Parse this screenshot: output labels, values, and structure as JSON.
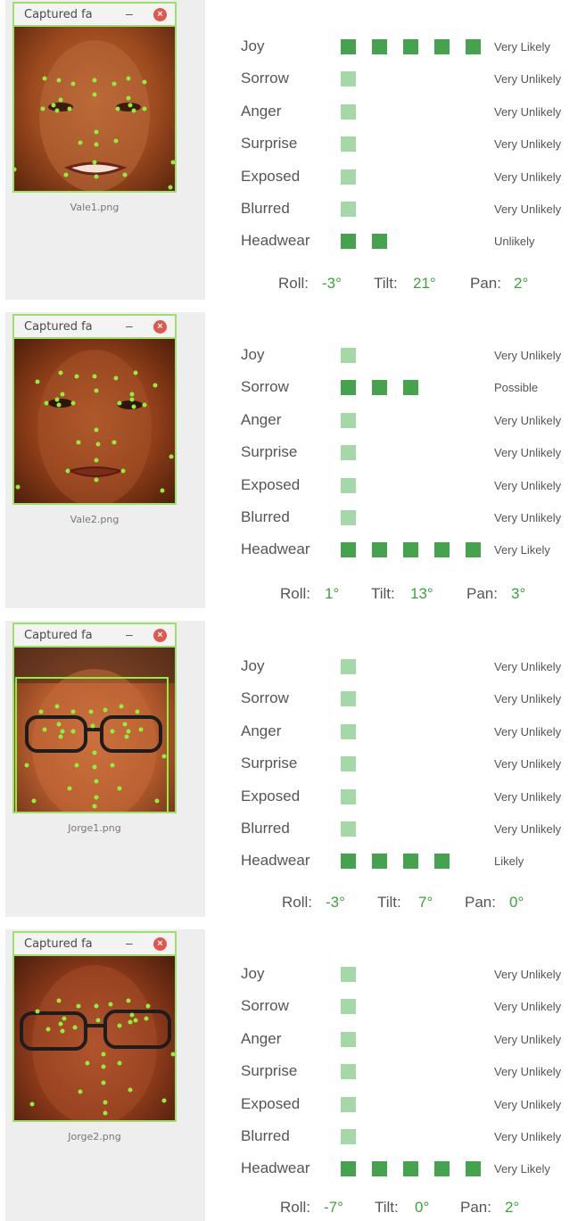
{
  "entries": [
    {
      "window_title": "Captured fa",
      "filename": "Vale1.png",
      "rows": [
        {
          "label": "Joy",
          "level": 5,
          "likelihood": "Very Likely"
        },
        {
          "label": "Sorrow",
          "level": 1,
          "likelihood": "Very Unlikely"
        },
        {
          "label": "Anger",
          "level": 1,
          "likelihood": "Very Unlikely"
        },
        {
          "label": "Surprise",
          "level": 1,
          "likelihood": "Very Unlikely"
        },
        {
          "label": "Exposed",
          "level": 1,
          "likelihood": "Very Unlikely"
        },
        {
          "label": "Blurred",
          "level": 1,
          "likelihood": "Very Unlikely"
        },
        {
          "label": "Headwear",
          "level": 2,
          "likelihood": "Unlikely"
        }
      ],
      "roll_label": "Roll:",
      "roll": "-3°",
      "tilt_label": "Tilt:",
      "tilt": "21°",
      "pan_label": "Pan:",
      "pan": "2°"
    },
    {
      "window_title": "Captured fa",
      "filename": "Vale2.png",
      "rows": [
        {
          "label": "Joy",
          "level": 1,
          "likelihood": "Very Unlikely"
        },
        {
          "label": "Sorrow",
          "level": 3,
          "likelihood": "Possible"
        },
        {
          "label": "Anger",
          "level": 1,
          "likelihood": "Very Unlikely"
        },
        {
          "label": "Surprise",
          "level": 1,
          "likelihood": "Very Unlikely"
        },
        {
          "label": "Exposed",
          "level": 1,
          "likelihood": "Very Unlikely"
        },
        {
          "label": "Blurred",
          "level": 1,
          "likelihood": "Very Unlikely"
        },
        {
          "label": "Headwear",
          "level": 5,
          "likelihood": "Very Likely"
        }
      ],
      "roll_label": "Roll:",
      "roll": "1°",
      "tilt_label": "Tilt:",
      "tilt": "13°",
      "pan_label": "Pan:",
      "pan": "3°"
    },
    {
      "window_title": "Captured fa",
      "filename": "Jorge1.png",
      "rows": [
        {
          "label": "Joy",
          "level": 1,
          "likelihood": "Very Unlikely"
        },
        {
          "label": "Sorrow",
          "level": 1,
          "likelihood": "Very Unlikely"
        },
        {
          "label": "Anger",
          "level": 1,
          "likelihood": "Very Unlikely"
        },
        {
          "label": "Surprise",
          "level": 1,
          "likelihood": "Very Unlikely"
        },
        {
          "label": "Exposed",
          "level": 1,
          "likelihood": "Very Unlikely"
        },
        {
          "label": "Blurred",
          "level": 1,
          "likelihood": "Very Unlikely"
        },
        {
          "label": "Headwear",
          "level": 4,
          "likelihood": "Likely"
        }
      ],
      "roll_label": "Roll:",
      "roll": "-3°",
      "tilt_label": "Tilt:",
      "tilt": "7°",
      "pan_label": "Pan:",
      "pan": "0°"
    },
    {
      "window_title": "Captured fa",
      "filename": "Jorge2.png",
      "rows": [
        {
          "label": "Joy",
          "level": 1,
          "likelihood": "Very Unlikely"
        },
        {
          "label": "Sorrow",
          "level": 1,
          "likelihood": "Very Unlikely"
        },
        {
          "label": "Anger",
          "level": 1,
          "likelihood": "Very Unlikely"
        },
        {
          "label": "Surprise",
          "level": 1,
          "likelihood": "Very Unlikely"
        },
        {
          "label": "Exposed",
          "level": 1,
          "likelihood": "Very Unlikely"
        },
        {
          "label": "Blurred",
          "level": 1,
          "likelihood": "Very Unlikely"
        },
        {
          "label": "Headwear",
          "level": 5,
          "likelihood": "Very Likely"
        }
      ],
      "roll_label": "Roll:",
      "roll": "-7°",
      "tilt_label": "Tilt:",
      "tilt": "0°",
      "pan_label": "Pan:",
      "pan": "2°"
    }
  ],
  "colors": {
    "level_on": "#46a34d",
    "level_off": "#a4d8a7",
    "angle_value": "#3da33d",
    "window_border": "#9ae06a",
    "close_button": "#e2574c",
    "landmark_dot": "#8ef03a"
  },
  "icons": {
    "minimize": "minimize-icon",
    "close": "close-icon"
  }
}
